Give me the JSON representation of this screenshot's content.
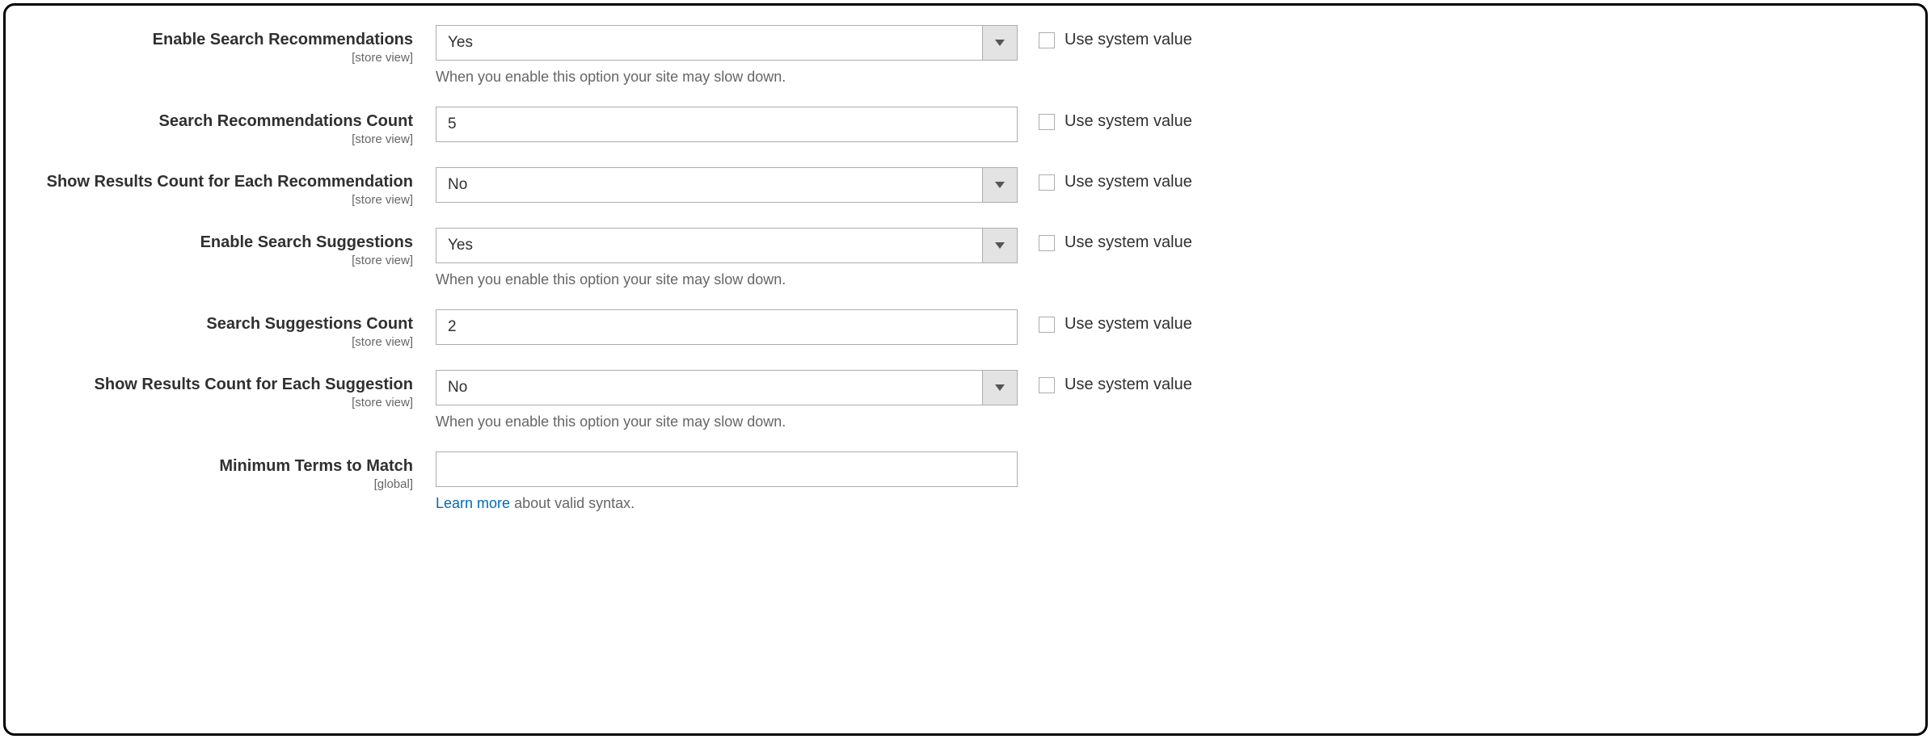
{
  "common": {
    "use_system_value": "Use system value",
    "scope_store": "[store view]",
    "scope_global": "[global]",
    "slow_hint": "When you enable this option your site may slow down.",
    "learn_more": "Learn more",
    "learn_more_tail": " about valid syntax."
  },
  "fields": {
    "enable_recommendations": {
      "label": "Enable Search Recommendations",
      "value": "Yes"
    },
    "recommendations_count": {
      "label": "Search Recommendations Count",
      "value": "5"
    },
    "show_rec_results_count": {
      "label": "Show Results Count for Each Recommendation",
      "value": "No"
    },
    "enable_suggestions": {
      "label": "Enable Search Suggestions",
      "value": "Yes"
    },
    "suggestions_count": {
      "label": "Search Suggestions Count",
      "value": "2"
    },
    "show_sug_results_count": {
      "label": "Show Results Count for Each Suggestion",
      "value": "No"
    },
    "min_terms": {
      "label": "Minimum Terms to Match",
      "value": ""
    }
  }
}
